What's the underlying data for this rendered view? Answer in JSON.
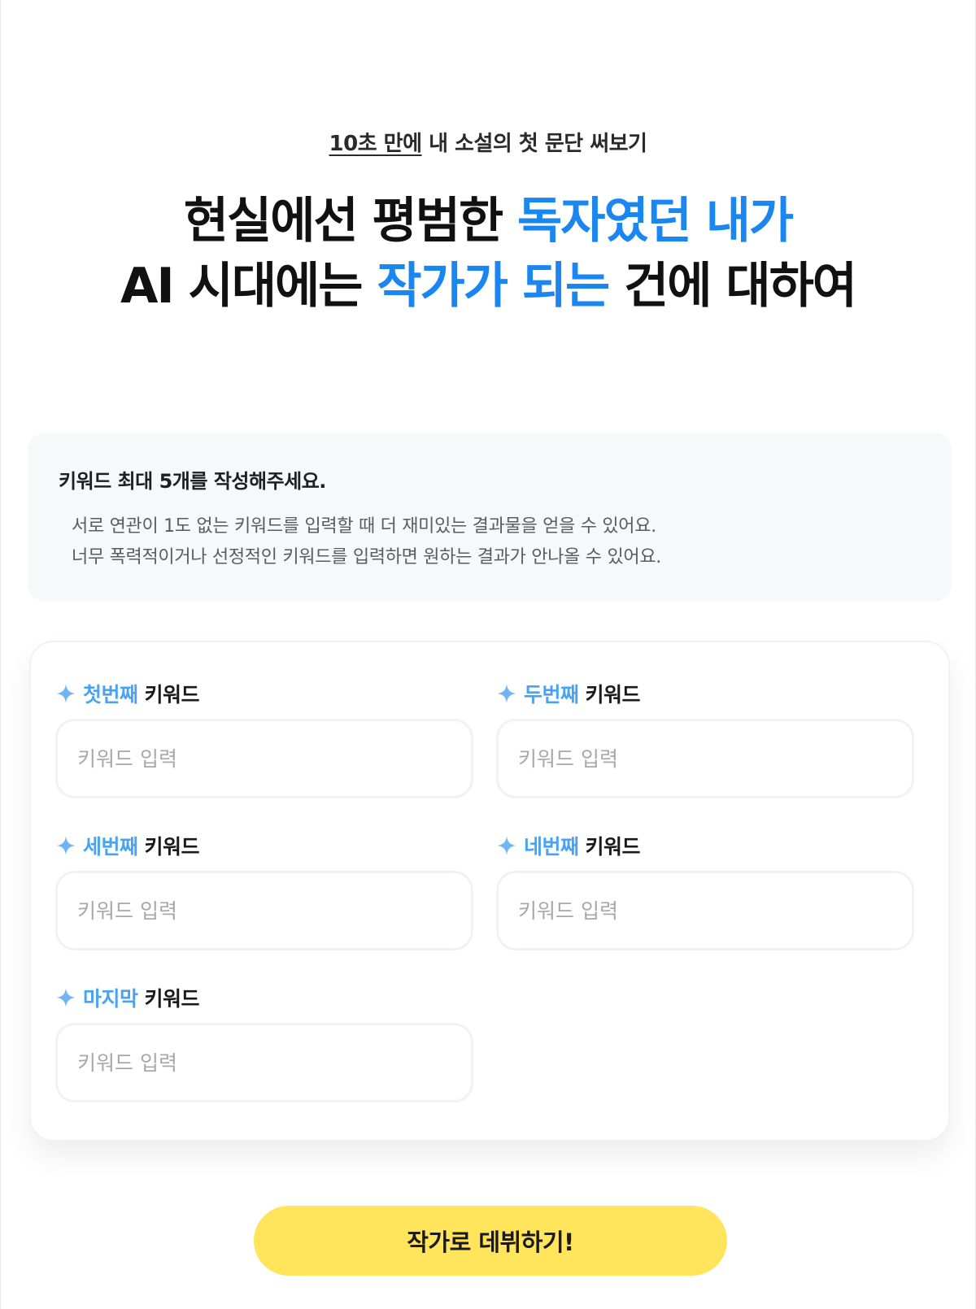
{
  "eyebrow": {
    "underlined": "10초 만에",
    "rest": " 내 소설의 첫 문단 써보기"
  },
  "headline": {
    "line1_dark": "현실에선 평범한 ",
    "line1_blue": "독자였던 내가",
    "line2_dark_a": "AI 시대에는 ",
    "line2_blue": "작가가 되는",
    "line2_dark_b": " 건에 대하여"
  },
  "notice": {
    "title": "키워드 최대 5개를 작성해주세요.",
    "lines": [
      "서로 연관이 1도 없는 키워드를 입력할 때 더 재미있는 결과물을 얻을 수 있어요.",
      "너무 폭력적이거나 선정적인 키워드를 입력하면 원하는 결과가 안나올 수 있어요."
    ]
  },
  "fields": [
    {
      "ordinal": "첫번째",
      "suffix": "키워드",
      "placeholder": "키워드 입력",
      "value": ""
    },
    {
      "ordinal": "두번째",
      "suffix": "키워드",
      "placeholder": "키워드 입력",
      "value": ""
    },
    {
      "ordinal": "세번째",
      "suffix": "키워드",
      "placeholder": "키워드 입력",
      "value": ""
    },
    {
      "ordinal": "네번째",
      "suffix": "키워드",
      "placeholder": "키워드 입력",
      "value": ""
    },
    {
      "ordinal": "마지막",
      "suffix": "키워드",
      "placeholder": "키워드 입력",
      "value": ""
    }
  ],
  "icons": {
    "label_icon": "sparkle-icon"
  },
  "colors": {
    "accent_blue": "#1a86f0",
    "label_blue": "#4aa3f2",
    "cta_yellow": "#ffe45c"
  },
  "cta": {
    "label": "작가로 데뷔하기!"
  }
}
